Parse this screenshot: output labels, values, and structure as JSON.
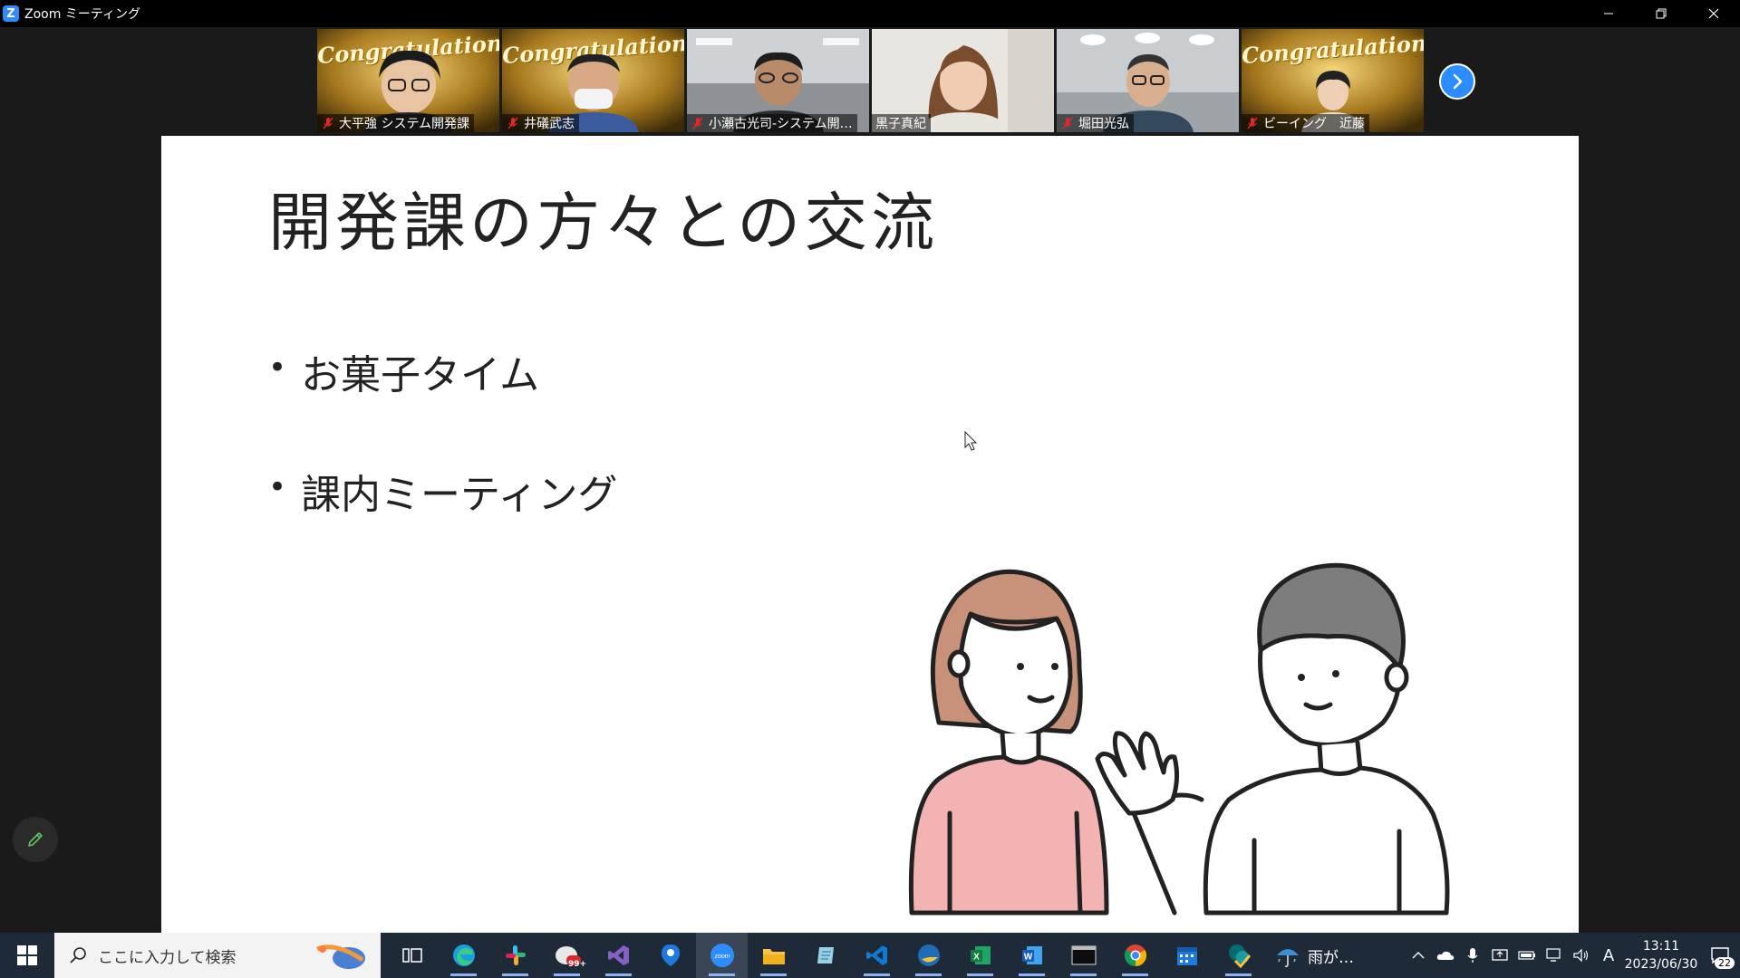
{
  "window": {
    "title": "Zoom ミーティング",
    "app_icon_letter": "Z"
  },
  "participants": [
    {
      "name": "大平強 システム開発課",
      "muted": true,
      "background": "congratulations",
      "bg_text": "Congratulations!"
    },
    {
      "name": "井礒武志",
      "muted": true,
      "background": "congratulations",
      "bg_text": "Congratulations!"
    },
    {
      "name": "小瀬古光司-システム開…",
      "muted": true,
      "background": "office"
    },
    {
      "name": "黒子真紀",
      "muted": false,
      "background": "room",
      "active_speaker": true
    },
    {
      "name": "堀田光弘",
      "muted": true,
      "background": "office"
    },
    {
      "name": "ビーイング　近藤",
      "muted": true,
      "background": "congratulations",
      "bg_text": "Congratulations!"
    }
  ],
  "slide": {
    "title": "開発課の方々との交流",
    "bullets": [
      "お菓子タイム",
      "課内ミーティング"
    ],
    "bullet_glyph": "•"
  },
  "taskbar": {
    "search_placeholder": "ここに入力して検索",
    "weather_text": "雨が…",
    "clock_time": "13:11",
    "clock_date": "2023/06/30",
    "ime_indicator": "A",
    "notification_count": "22",
    "mail_badge": "99+",
    "apps": [
      "task-view",
      "edge",
      "slack",
      "mail",
      "visual-studio",
      "maps",
      "zoom",
      "file-explorer",
      "notepad",
      "vscode",
      "edge-dev",
      "excel",
      "word",
      "terminal",
      "chrome",
      "calendar",
      "sharepoint"
    ]
  },
  "colors": {
    "zoom_blue": "#2d8cff",
    "active_speaker_border": "#a5d36c",
    "taskbar": "#1f2a38",
    "slide_bg": "#ffffff"
  }
}
